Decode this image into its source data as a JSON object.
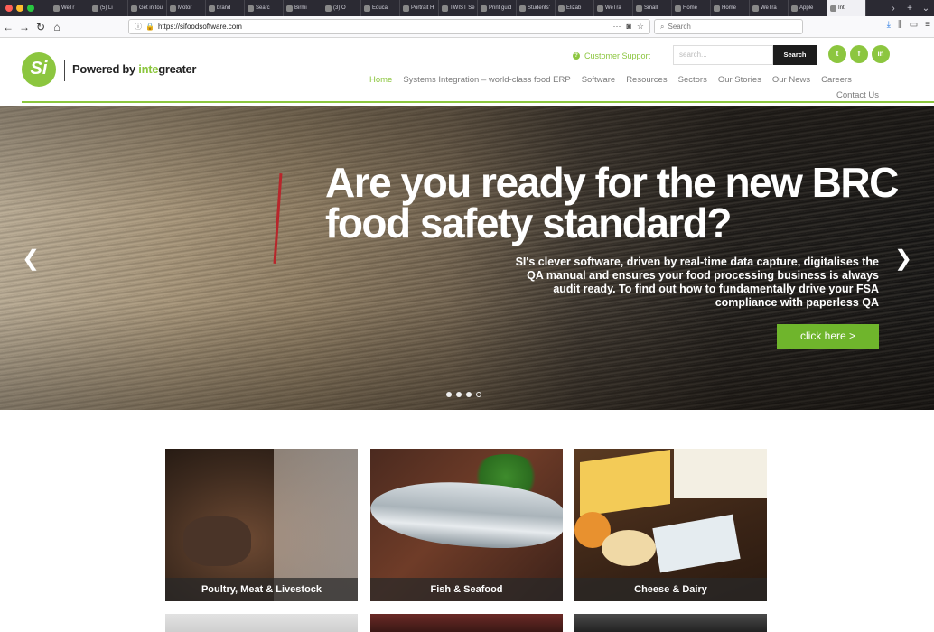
{
  "browser": {
    "tabs": [
      {
        "label": "WeTr"
      },
      {
        "label": "(5) Li"
      },
      {
        "label": "Get in tou"
      },
      {
        "label": "Motor"
      },
      {
        "label": "brand"
      },
      {
        "label": "Searc"
      },
      {
        "label": "Birmi"
      },
      {
        "label": "(3) O"
      },
      {
        "label": "Educa"
      },
      {
        "label": "Portrait H"
      },
      {
        "label": "TWIST Se"
      },
      {
        "label": "Print guid"
      },
      {
        "label": "Students'"
      },
      {
        "label": "Elizab"
      },
      {
        "label": "WeTra"
      },
      {
        "label": "Small"
      },
      {
        "label": "Home"
      },
      {
        "label": "Home"
      },
      {
        "label": "WeTra"
      },
      {
        "label": "Apple"
      },
      {
        "label": "Int"
      }
    ],
    "url": "https://sifoodsoftware.com",
    "search_placeholder": "Search"
  },
  "header": {
    "logo_mark": "Si",
    "logo_prefix": "Powered by ",
    "logo_accent": "inte",
    "logo_suffix": "greater",
    "support": "Customer Support",
    "search_placeholder": "search...",
    "search_button": "Search",
    "social": [
      "t",
      "f",
      "in"
    ],
    "nav": [
      {
        "label": "Home",
        "active": true
      },
      {
        "label": "Systems Integration – world-class food ERP"
      },
      {
        "label": "Software"
      },
      {
        "label": "Resources"
      },
      {
        "label": "Sectors"
      },
      {
        "label": "Our Stories"
      },
      {
        "label": "Our News"
      },
      {
        "label": "Careers"
      }
    ],
    "contact": "Contact Us"
  },
  "hero": {
    "title": "Are you ready for the new BRC food safety standard?",
    "body": "SI's clever software, driven by real-time data capture, digitalises the QA manual and ensures your food processing business is always audit ready. To find out how to fundamentally drive your FSA compliance with paperless QA",
    "cta": "click here >",
    "slide_count": 4,
    "active_slide": 1
  },
  "sectors": [
    {
      "label": "Poultry, Meat & Livestock"
    },
    {
      "label": "Fish & Seafood"
    },
    {
      "label": "Cheese & Dairy"
    }
  ],
  "colors": {
    "brand_green": "#8cc63f",
    "cta_green": "#6fb52c",
    "nav_grey": "#7b7b7b"
  }
}
